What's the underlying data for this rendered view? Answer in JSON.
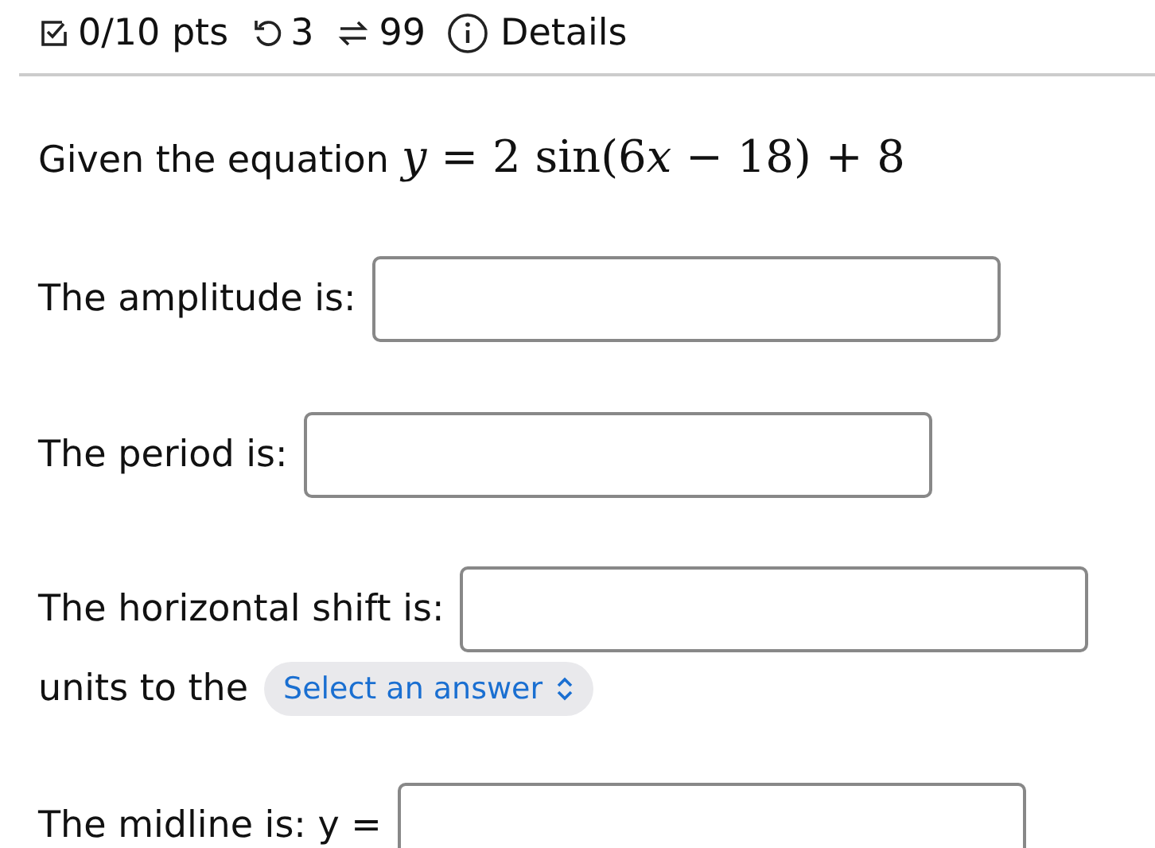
{
  "header": {
    "score": "0/10 pts",
    "attempts": "3",
    "submissions": "99",
    "details": "Details"
  },
  "question": {
    "intro": "Given the equation",
    "equation": [
      {
        "text": "y",
        "kind": "variable"
      },
      {
        "text": " = 2 sin(6",
        "kind": "plain"
      },
      {
        "text": "x",
        "kind": "variable"
      },
      {
        "text": " − 18) + 8",
        "kind": "plain"
      }
    ]
  },
  "fields": [
    {
      "label": "The amplitude is:",
      "kind": "input"
    },
    {
      "label": "The period is:",
      "kind": "input"
    },
    {
      "label": "The horizontal shift is:",
      "kind": "input"
    },
    {
      "label": "units to the",
      "kind": "select",
      "placeholder": "Select an answer"
    },
    {
      "label": "The midline is: y =",
      "kind": "input"
    }
  ]
}
